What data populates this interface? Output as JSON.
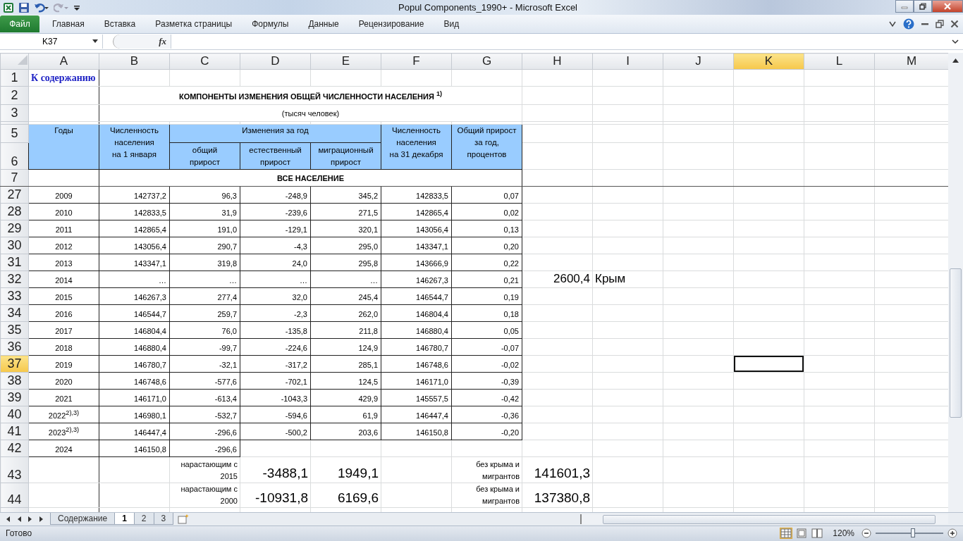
{
  "window": {
    "title": "Popul Components_1990+  -  Microsoft Excel"
  },
  "ribbon": {
    "file_tab": "Файл",
    "tabs": [
      "Главная",
      "Вставка",
      "Разметка страницы",
      "Формулы",
      "Данные",
      "Рецензирование",
      "Вид"
    ]
  },
  "formula_bar": {
    "name_box": "K37",
    "fx_label": "fx"
  },
  "columns": [
    {
      "label": "A",
      "selected": false
    },
    {
      "label": "B",
      "selected": false
    },
    {
      "label": "C",
      "selected": false
    },
    {
      "label": "D",
      "selected": false
    },
    {
      "label": "E",
      "selected": false
    },
    {
      "label": "F",
      "selected": false
    },
    {
      "label": "G",
      "selected": false
    },
    {
      "label": "H",
      "selected": false
    },
    {
      "label": "I",
      "selected": false
    },
    {
      "label": "J",
      "selected": false
    },
    {
      "label": "K",
      "selected": true
    },
    {
      "label": "L",
      "selected": false
    },
    {
      "label": "M",
      "selected": false
    }
  ],
  "sheet": {
    "link": {
      "row": "1",
      "text": "К содержанию"
    },
    "title": {
      "row": "2",
      "text": "КОМПОНЕНТЫ ИЗМЕНЕНИЯ ОБЩЕЙ ЧИСЛЕННОСТИ НАСЕЛЕНИЯ $^{1)}$"
    },
    "subtitle": {
      "row": "3",
      "text": "(тысяч человек)"
    },
    "header": {
      "rows": [
        "5",
        "6"
      ],
      "years": "Годы",
      "pop_start": "Численность\nнаселения\nна 1 января",
      "changes": "Изменения за год",
      "total": "общий\nприрост",
      "natural": "естественный\nприрост",
      "migration": "миграционный\nприрост",
      "pop_end": "Численность\nнаселения\nна 31 декабря",
      "growth_pct": "Общий прирост\nза год,\nпроцентов"
    },
    "section": {
      "row": "7",
      "text": "ВСЕ НАСЕЛЕНИЕ"
    },
    "data_rows": [
      {
        "row": "27",
        "selected": false,
        "year": "2009",
        "values": [
          "142737,2",
          "96,3",
          "-248,9",
          "345,2",
          "142833,5",
          "0,07"
        ]
      },
      {
        "row": "28",
        "selected": false,
        "year": "2010",
        "values": [
          "142833,5",
          "31,9",
          "-239,6",
          "271,5",
          "142865,4",
          "0,02"
        ]
      },
      {
        "row": "29",
        "selected": false,
        "year": "2011",
        "values": [
          "142865,4",
          "191,0",
          "-129,1",
          "320,1",
          "143056,4",
          "0,13"
        ]
      },
      {
        "row": "30",
        "selected": false,
        "year": "2012",
        "values": [
          "143056,4",
          "290,7",
          "-4,3",
          "295,0",
          "143347,1",
          "0,20"
        ]
      },
      {
        "row": "31",
        "selected": false,
        "year": "2013",
        "values": [
          "143347,1",
          "319,8",
          "24,0",
          "295,8",
          "143666,9",
          "0,22"
        ]
      },
      {
        "row": "32",
        "selected": false,
        "year": "2014",
        "values": [
          "…",
          "…",
          "…",
          "…",
          "146267,3",
          "0,21"
        ],
        "note_value": "2600,4",
        "note_label": "Крым"
      },
      {
        "row": "33",
        "selected": false,
        "year": "2015",
        "values": [
          "146267,3",
          "277,4",
          "32,0",
          "245,4",
          "146544,7",
          "0,19"
        ]
      },
      {
        "row": "34",
        "selected": false,
        "year": "2016",
        "values": [
          "146544,7",
          "259,7",
          "-2,3",
          "262,0",
          "146804,4",
          "0,18"
        ]
      },
      {
        "row": "35",
        "selected": false,
        "year": "2017",
        "values": [
          "146804,4",
          "76,0",
          "-135,8",
          "211,8",
          "146880,4",
          "0,05"
        ]
      },
      {
        "row": "36",
        "selected": false,
        "year": "2018",
        "values": [
          "146880,4",
          "-99,7",
          "-224,6",
          "124,9",
          "146780,7",
          "-0,07"
        ]
      },
      {
        "row": "37",
        "selected": true,
        "year": "2019",
        "values": [
          "146780,7",
          "-32,1",
          "-317,2",
          "285,1",
          "146748,6",
          "-0,02"
        ]
      },
      {
        "row": "38",
        "selected": false,
        "year": "2020",
        "values": [
          "146748,6",
          "-577,6",
          "-702,1",
          "124,5",
          "146171,0",
          "-0,39"
        ]
      },
      {
        "row": "39",
        "selected": false,
        "year": "2021",
        "values": [
          "146171,0",
          "-613,4",
          "-1043,3",
          "429,9",
          "145557,5",
          "-0,42"
        ]
      },
      {
        "row": "40",
        "selected": false,
        "year": "2022$^{2),3)}$",
        "values": [
          "146980,1",
          "-532,7",
          "-594,6",
          "61,9",
          "146447,4",
          "-0,36"
        ]
      },
      {
        "row": "41",
        "selected": false,
        "year": "2023$^{2),3)}$",
        "values": [
          "146447,4",
          "-296,6",
          "-500,2",
          "203,6",
          "146150,8",
          "-0,20"
        ]
      },
      {
        "row": "42",
        "selected": false,
        "year": "2024",
        "values": [
          "146150,8",
          "-296,6"
        ]
      }
    ],
    "summary_rows": [
      {
        "row": "43",
        "label": "нарастающим с\n2015",
        "natural": "-3488,1",
        "migration": "1949,1",
        "note": "без крыма и\nмигрантов",
        "result": "141601,3"
      },
      {
        "row": "44",
        "label": "нарастающим с\n2000",
        "natural": "-10931,8",
        "migration": "6169,6",
        "note": "без крыма и\nмигрантов",
        "result": "137380,8"
      }
    ]
  },
  "sheet_tabs": [
    {
      "label": "Содержание",
      "selected": false
    },
    {
      "label": "1",
      "selected": true
    },
    {
      "label": "2",
      "selected": false
    },
    {
      "label": "3",
      "selected": false
    }
  ],
  "status_bar": {
    "status": "Готово",
    "zoom": "120%",
    "zoom_slider": {
      "level": 0.55
    }
  }
}
